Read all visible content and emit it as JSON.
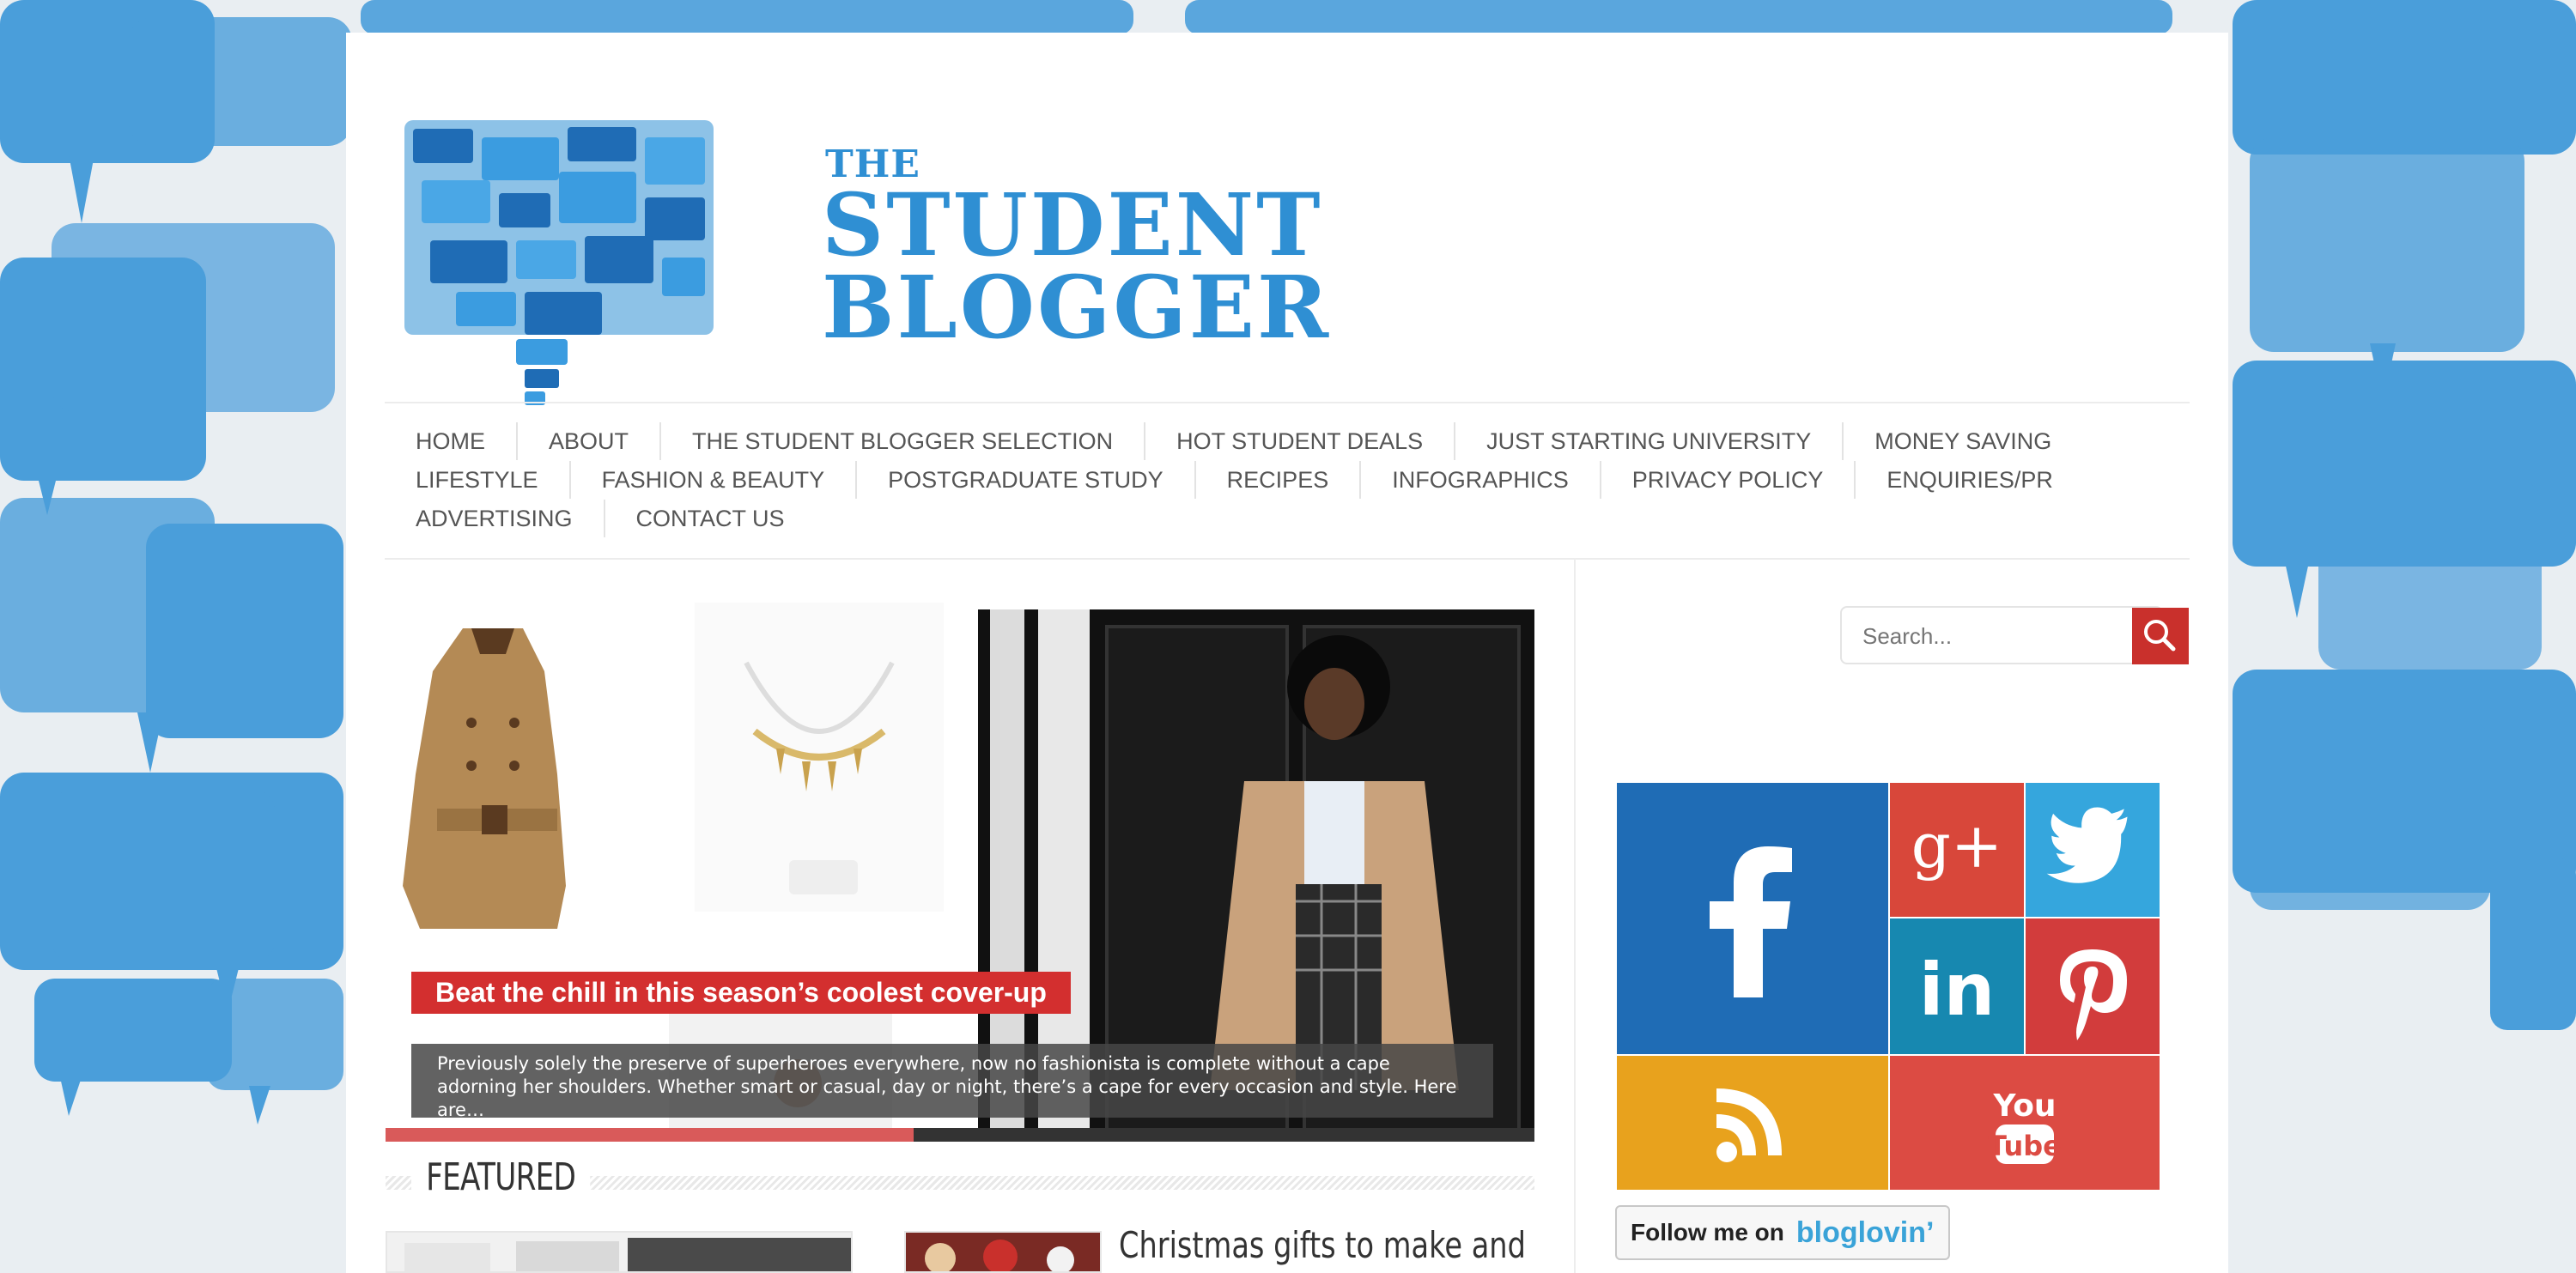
{
  "header": {
    "logo_small": "THE",
    "logo_line1": "STUDENT",
    "logo_line2": "BLOGGER"
  },
  "nav": {
    "row1": [
      "HOME",
      "ABOUT",
      "THE STUDENT BLOGGER SELECTION",
      "HOT STUDENT DEALS",
      "JUST STARTING UNIVERSITY",
      "MONEY SAVING"
    ],
    "row2": [
      "LIFESTYLE",
      "FASHION & BEAUTY",
      "POSTGRADUATE STUDY",
      "RECIPES",
      "INFOGRAPHICS",
      "PRIVACY POLICY",
      "ENQUIRIES/PR"
    ],
    "row3": [
      "ADVERTISING",
      "CONTACT US"
    ]
  },
  "slider": {
    "title": "Beat the chill in this season’s coolest cover-up",
    "description": "Previously solely the preserve of superheroes everywhere, now no fashionista is complete without a cape adorning her shoulders. Whether smart or casual, day or night, there’s a cape for every occasion and style. Here are…",
    "progress": 0.46
  },
  "featured": {
    "heading": "FEATURED",
    "post_title": "Christmas gifts to make and"
  },
  "sidebar": {
    "search_placeholder": "Search...",
    "social": [
      {
        "name": "facebook",
        "icon": "facebook-icon",
        "color": "#1f6cb5"
      },
      {
        "name": "google-plus",
        "icon": "google-plus-icon",
        "label": "g+",
        "color": "#d8473a"
      },
      {
        "name": "twitter",
        "icon": "twitter-icon",
        "color": "#35a6dd"
      },
      {
        "name": "linkedin",
        "icon": "linkedin-icon",
        "label": "in",
        "color": "#1788b0"
      },
      {
        "name": "pinterest",
        "icon": "pinterest-icon",
        "color": "#d23c3c"
      },
      {
        "name": "rss",
        "icon": "rss-icon",
        "color": "#e8a21d"
      },
      {
        "name": "youtube",
        "icon": "youtube-icon",
        "label_top": "You",
        "label_bottom": "Tube",
        "color": "#dc4b43"
      }
    ],
    "bloglovin": {
      "prefix": "Follow me on",
      "brand": "bloglovin’"
    }
  },
  "colors": {
    "accent_blue": "#2f8fd3",
    "accent_red": "#c9302c"
  }
}
